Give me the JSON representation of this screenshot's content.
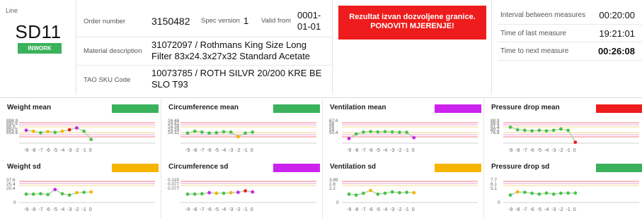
{
  "line": {
    "caption": "Line",
    "value": "SD11",
    "status": "INWORK"
  },
  "order": {
    "order_number_label": "Order number",
    "order_number": "3150482",
    "spec_version_label": "Spec version",
    "spec_version": "1",
    "valid_from_label": "Valid from",
    "valid_from_line1": "0001-",
    "valid_from_line2": "01-01",
    "material_label": "Material description",
    "material_line1": "31072097 / Rothmans King Size Long",
    "material_line2": "Filter 83x24.3x27x32 Standard Acetate",
    "tao_label": "TAO SKU Code",
    "tao_line1": "10073785 / ROTH SILVR 20/200 KRE BE",
    "tao_line2": "SLO T93"
  },
  "alert": {
    "line1": "Rezultat izvan dozvoljene granice.",
    "line2": "PONOVITI MJERENJE!"
  },
  "times": {
    "interval_label": "Interval between measures",
    "interval_value": "00:20:00",
    "last_label": "Time of last measure",
    "last_value": "19:21:01",
    "next_label": "Time to next measure",
    "next_value": "00:26:08"
  },
  "colors": {
    "green": "#3ab15b",
    "red": "#ee1c1c",
    "yellow": "#f7b500",
    "magenta": "#cc22ee",
    "point_green": "#4cc24a",
    "limit_red": "#ef7b86",
    "limit_pink": "#f2a3d6",
    "limit_yellow": "#f3d98a"
  },
  "x_ticks": [
    "-9",
    "-8",
    "-7",
    "-6",
    "-5",
    "-4",
    "-3",
    "-2",
    "-1",
    "0"
  ],
  "charts": [
    {
      "title": "Weight mean",
      "status_color": "#3ab15b",
      "ylabels": [
        "898.9",
        "89x.9",
        "86.6",
        "85x.5",
        "854.6"
      ],
      "yzero": "",
      "values": [
        0.55,
        0.5,
        0.42,
        0.48,
        0.44,
        0.5,
        0.58,
        0.68,
        0.5,
        0.05
      ],
      "pcolors": [
        "#cc22ee",
        "#f7b500",
        "#4cc24a",
        "#f7b500",
        "#4cc24a",
        "#f7b500",
        "#ee1c1c",
        "#cc22ee",
        "#4cc24a",
        "#4cc24a"
      ]
    },
    {
      "title": "Circumference mean",
      "status_color": "#3ab15b",
      "ylabels": [
        "24.46",
        "24.42",
        "24.38",
        "24.34",
        "24.32"
      ],
      "yzero": "",
      "values": [
        0.4,
        0.5,
        0.45,
        0.4,
        0.42,
        0.47,
        0.45,
        0.2,
        0.4,
        0.45
      ],
      "pcolors": [
        "#4cc24a",
        "#4cc24a",
        "#4cc24a",
        "#4cc24a",
        "#4cc24a",
        "#4cc24a",
        "#4cc24a",
        "#f7b500",
        "#4cc24a",
        "#4cc24a"
      ]
    },
    {
      "title": "Ventilation mean",
      "status_color": "#cc22ee",
      "ylabels": [
        "67.6",
        "58",
        "56",
        "54",
        "50.4"
      ],
      "yzero": "",
      "values": [
        0.1,
        0.35,
        0.45,
        0.48,
        0.46,
        0.48,
        0.46,
        0.44,
        0.44,
        0.15
      ],
      "pcolors": [
        "#cc22ee",
        "#4cc24a",
        "#4cc24a",
        "#4cc24a",
        "#4cc24a",
        "#4cc24a",
        "#4cc24a",
        "#4cc24a",
        "#4cc24a",
        "#cc22ee"
      ]
    },
    {
      "title": "Pressure drop mean",
      "status_color": "#ee1c1c",
      "ylabels": [
        "88.9",
        "86.6",
        "81.4",
        "80.2",
        "76.8"
      ],
      "yzero": "",
      "values": [
        0.72,
        0.58,
        0.55,
        0.52,
        0.55,
        0.52,
        0.55,
        0.62,
        0.55,
        -0.1
      ],
      "pcolors": [
        "#4cc24a",
        "#4cc24a",
        "#4cc24a",
        "#4cc24a",
        "#4cc24a",
        "#4cc24a",
        "#4cc24a",
        "#4cc24a",
        "#4cc24a",
        "#ee1c1c"
      ]
    },
    {
      "title": "Weight sd",
      "status_color": "#f7b500",
      "ylabels": [
        "37.6",
        "25.4",
        "20.4"
      ],
      "yzero": "0",
      "values": [
        0.3,
        0.3,
        0.32,
        0.28,
        0.55,
        0.32,
        0.25,
        0.38,
        0.4,
        0.42
      ],
      "pcolors": [
        "#4cc24a",
        "#4cc24a",
        "#4cc24a",
        "#4cc24a",
        "#cc22ee",
        "#4cc24a",
        "#4cc24a",
        "#f7b500",
        "#4cc24a",
        "#f7b500"
      ]
    },
    {
      "title": "Circumference sd",
      "status_color": "#cc22ee",
      "ylabels": [
        "0.119",
        "0.077",
        "0.077"
      ],
      "yzero": "",
      "values": [
        0.3,
        0.3,
        0.32,
        0.38,
        0.35,
        0.35,
        0.38,
        0.4,
        0.48,
        0.42
      ],
      "pcolors": [
        "#4cc24a",
        "#4cc24a",
        "#4cc24a",
        "#cc22ee",
        "#f7b500",
        "#4cc24a",
        "#f7b500",
        "#cc22ee",
        "#ee1c1c",
        "#cc22ee"
      ]
    },
    {
      "title": "Ventilation sd",
      "status_color": "#f7b500",
      "ylabels": [
        "3.89",
        "2.8",
        "2.2"
      ],
      "yzero": "0",
      "values": [
        0.3,
        0.25,
        0.35,
        0.5,
        0.3,
        0.35,
        0.42,
        0.38,
        0.4,
        0.38
      ],
      "pcolors": [
        "#4cc24a",
        "#4cc24a",
        "#4cc24a",
        "#f7b500",
        "#4cc24a",
        "#4cc24a",
        "#4cc24a",
        "#4cc24a",
        "#4cc24a",
        "#f7b500"
      ]
    },
    {
      "title": "Pressure drop sd",
      "status_color": "#3ab15b",
      "ylabels": [
        "7.7",
        "6.1",
        "5.1"
      ],
      "yzero": "0",
      "values": [
        0.25,
        0.42,
        0.4,
        0.35,
        0.3,
        0.36,
        0.3,
        0.35,
        0.36,
        0.36
      ],
      "pcolors": [
        "#4cc24a",
        "#f7b500",
        "#4cc24a",
        "#4cc24a",
        "#4cc24a",
        "#4cc24a",
        "#4cc24a",
        "#4cc24a",
        "#4cc24a",
        "#4cc24a"
      ]
    }
  ]
}
